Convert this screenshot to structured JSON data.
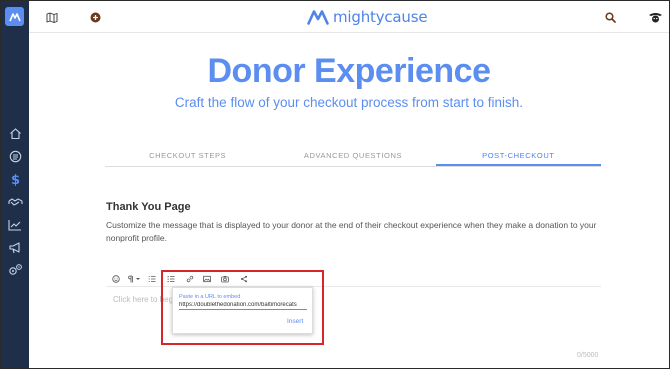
{
  "brand": {
    "name": "mightycause",
    "color": "#4f83e8"
  },
  "colors": {
    "sidebar": "#1f2f4a",
    "accent": "#5b8ef0",
    "highlight": "#d7262b"
  },
  "topbar": {
    "left_icons": [
      "map-icon",
      "plus-circle-icon"
    ],
    "right_icons": [
      "search-icon",
      "user-avatar-icon"
    ]
  },
  "sidebar": {
    "items": [
      {
        "icon": "home-icon"
      },
      {
        "icon": "list-icon"
      },
      {
        "icon": "dollar-icon"
      },
      {
        "icon": "handshake-icon"
      },
      {
        "icon": "chart-icon"
      },
      {
        "icon": "megaphone-icon"
      },
      {
        "icon": "settings-icon"
      }
    ]
  },
  "page": {
    "title": "Donor Experience",
    "subtitle": "Craft the flow of your checkout process from start to finish."
  },
  "tabs": [
    {
      "label": "CHECKOUT STEPS",
      "active": false
    },
    {
      "label": "ADVANCED QUESTIONS",
      "active": false
    },
    {
      "label": "POST-CHECKOUT",
      "active": true
    }
  ],
  "section": {
    "title": "Thank You Page",
    "description": "Customize the message that is displayed to your donor at the end of their checkout experience when they make a donation to your nonprofit profile."
  },
  "editor": {
    "toolbar": [
      "emoji-icon",
      "paragraph-icon",
      "ordered-list-icon",
      "bullet-list-icon",
      "link-icon",
      "image-icon",
      "camera-icon",
      "share-icon"
    ],
    "placeholder": "Click here to begin",
    "counter": "0/5000"
  },
  "embed_popup": {
    "label": "Paste in a URL to embed",
    "value": "https://doublethedonation.com/baltimorecats",
    "insert_label": "Insert"
  }
}
